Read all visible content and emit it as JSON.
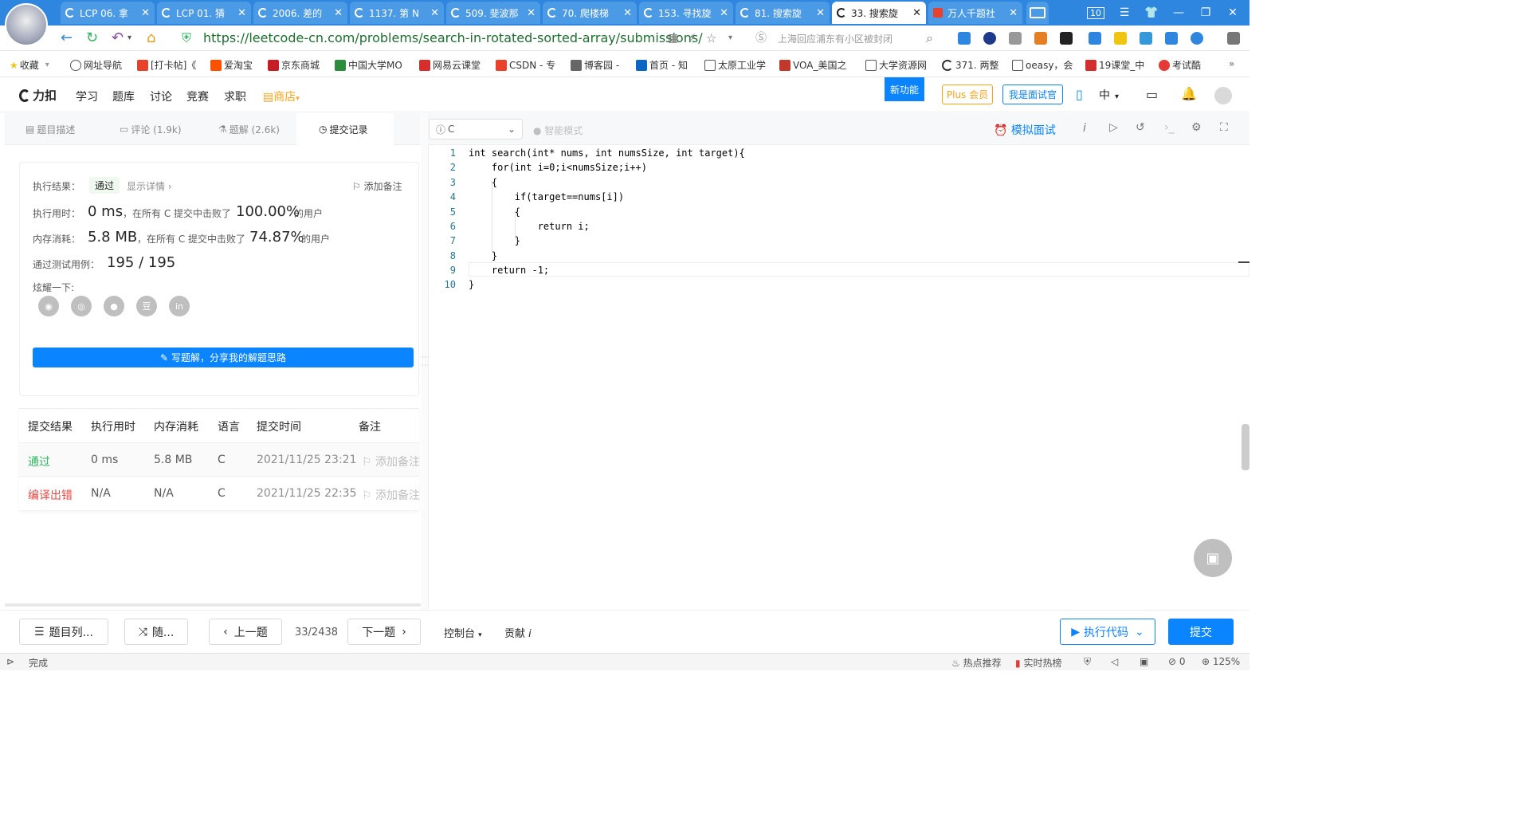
{
  "browser": {
    "tabs": [
      {
        "label": "LCP 06. 拿"
      },
      {
        "label": "LCP 01. 猜"
      },
      {
        "label": "2006. 差的"
      },
      {
        "label": "1137. 第 N"
      },
      {
        "label": "509. 斐波那"
      },
      {
        "label": "70. 爬楼梯"
      },
      {
        "label": "153. 寻找旋"
      },
      {
        "label": "81. 搜索旋"
      },
      {
        "label": "33. 搜索旋"
      },
      {
        "label": "万人千题社"
      }
    ],
    "tab_count": "10",
    "url": "https://leetcode-cn.com/problems/search-in-rotated-sorted-array/submissions/",
    "news": "上海回应浦东有小区被封闭",
    "bookmarks": [
      "收藏",
      "网址导航",
      "[打卡帖]《",
      "爱淘宝",
      "京东商城",
      "中国大学MO",
      "网易云课堂",
      "CSDN - 专",
      "博客园 -",
      "首页 - 知",
      "太原工业学",
      "VOA_美国之",
      "大学资源网",
      "371. 两整",
      "oeasy，会",
      "19课堂_中",
      "考试酷"
    ]
  },
  "nav": {
    "logo": "力扣",
    "items": [
      "学习",
      "题库",
      "讨论",
      "竞赛",
      "求职"
    ],
    "shop": "商店",
    "new_feature": "新功能",
    "plus": "Plus 会员",
    "interviewer": "我是面试官",
    "lang": "中"
  },
  "left_tabs": {
    "desc": "题目描述",
    "comments": "评论 (1.9k)",
    "solutions": "题解 (2.6k)",
    "submissions": "提交记录"
  },
  "result": {
    "exec_label": "执行结果：",
    "status": "通过",
    "details": "显示详情 ›",
    "add_note": "添加备注",
    "time_label": "执行用时：",
    "time_value": "0 ms",
    "time_text": "，在所有 C 提交中击败了",
    "time_pct": "100.00%",
    "users": "的用户",
    "mem_label": "内存消耗：",
    "mem_value": "5.8 MB",
    "mem_text": "，在所有 C 提交中击败了",
    "mem_pct": "74.87%",
    "cases_label": "通过测试用例：",
    "cases_value": "195 / 195",
    "share_label": "炫耀一下:",
    "write_btn": "写题解，分享我的解题思路"
  },
  "submissions": {
    "headers": [
      "提交结果",
      "执行用时",
      "内存消耗",
      "语言",
      "提交时间",
      "备注"
    ],
    "rows": [
      {
        "result": "通过",
        "time": "0 ms",
        "memory": "5.8 MB",
        "lang": "C",
        "date": "2021/11/25 23:21",
        "note": "添加备注"
      },
      {
        "result": "编译出错",
        "time": "N/A",
        "memory": "N/A",
        "lang": "C",
        "date": "2021/11/25 22:35",
        "note": "添加备注"
      }
    ]
  },
  "editor": {
    "language": "C",
    "smart_mode": "智能模式",
    "mock_interview": "模拟面试",
    "lines": [
      "int search(int* nums, int numsSize, int target){",
      "    for(int i=0;i<numsSize;i++)",
      "    {",
      "        if(target==nums[i])",
      "        {",
      "            return i;",
      "        }",
      "    }",
      "    return -1;",
      "}"
    ]
  },
  "bottom": {
    "problem_list": "题目列...",
    "random": "随...",
    "prev": "上一题",
    "page": "33/2438",
    "next": "下一题",
    "console": "控制台",
    "contribute": "贡献",
    "run": "执行代码",
    "submit": "提交"
  },
  "status_bar": {
    "done": "完成",
    "hot": "热点推荐",
    "realtime": "实时热榜",
    "count": "0",
    "zoom": "125%"
  },
  "colors": {
    "accent": "#0a84ff",
    "success": "#2db55d",
    "error": "#ef4743",
    "tabbar": "#2e86de"
  }
}
